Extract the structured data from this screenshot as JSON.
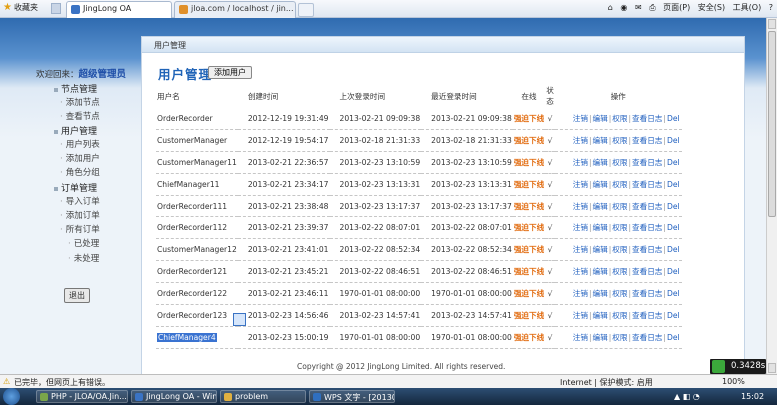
{
  "browser": {
    "favorites_label": "收藏夹",
    "tabs": [
      {
        "label": "JingLong OA",
        "active": true
      },
      {
        "label": "jloa.com / localhost / jin...",
        "active": false
      }
    ],
    "command_bar": [
      "页面(P)",
      "安全(S)",
      "工具(O)",
      "?"
    ]
  },
  "welcome": {
    "prefix": "欢迎回来：",
    "user": "超级管理员"
  },
  "sidebar": [
    {
      "label": "节点管理",
      "type": "cat"
    },
    {
      "label": "添加节点",
      "type": "sub"
    },
    {
      "label": "查看节点",
      "type": "sub"
    },
    {
      "label": "用户管理",
      "type": "cat"
    },
    {
      "label": "用户列表",
      "type": "sub"
    },
    {
      "label": "添加用户",
      "type": "sub"
    },
    {
      "label": "角色分组",
      "type": "sub"
    },
    {
      "label": "订单管理",
      "type": "cat"
    },
    {
      "label": "导入订单",
      "type": "sub"
    },
    {
      "label": "添加订单",
      "type": "sub"
    },
    {
      "label": "所有订单",
      "type": "sub"
    },
    {
      "label": "已处理",
      "type": "sub2"
    },
    {
      "label": "未处理",
      "type": "sub2"
    }
  ],
  "exit_label": "退出",
  "breadcrumb": "用户管理",
  "page_title": "用户管理",
  "add_user_label": "添加用户",
  "table": {
    "headers": [
      "用户名",
      "创建时间",
      "上次登录时间",
      "最近登录时间",
      "在线",
      "状态",
      "操作"
    ],
    "rows": [
      {
        "name": "OrderRecorder",
        "created": "2012-12-19 19:31:49",
        "last_login": "2013-02-21 09:09:38",
        "recent_login": "2013-02-21 09:09:38",
        "online": "强迫下线",
        "status": "√"
      },
      {
        "name": "CustomerManager",
        "created": "2012-12-19 19:54:17",
        "last_login": "2013-02-18 21:31:33",
        "recent_login": "2013-02-18 21:31:33",
        "online": "强迫下线",
        "status": "√"
      },
      {
        "name": "CustomerManager11",
        "created": "2013-02-21 22:36:57",
        "last_login": "2013-02-23 13:10:59",
        "recent_login": "2013-02-23 13:10:59",
        "online": "强迫下线",
        "status": "√"
      },
      {
        "name": "ChiefManager11",
        "created": "2013-02-21 23:34:17",
        "last_login": "2013-02-23 13:13:31",
        "recent_login": "2013-02-23 13:13:31",
        "online": "强迫下线",
        "status": "√"
      },
      {
        "name": "OrderRecorder111",
        "created": "2013-02-21 23:38:48",
        "last_login": "2013-02-23 13:17:37",
        "recent_login": "2013-02-23 13:17:37",
        "online": "强迫下线",
        "status": "√"
      },
      {
        "name": "OrderRecorder112",
        "created": "2013-02-21 23:39:37",
        "last_login": "2013-02-22 08:07:01",
        "recent_login": "2013-02-22 08:07:01",
        "online": "强迫下线",
        "status": "√"
      },
      {
        "name": "CustomerManager12",
        "created": "2013-02-21 23:41:01",
        "last_login": "2013-02-22 08:52:34",
        "recent_login": "2013-02-22 08:52:34",
        "online": "强迫下线",
        "status": "√"
      },
      {
        "name": "OrderRecorder121",
        "created": "2013-02-21 23:45:21",
        "last_login": "2013-02-22 08:46:51",
        "recent_login": "2013-02-22 08:46:51",
        "online": "强迫下线",
        "status": "√"
      },
      {
        "name": "OrderRecorder122",
        "created": "2013-02-21 23:46:11",
        "last_login": "1970-01-01 08:00:00",
        "recent_login": "1970-01-01 08:00:00",
        "online": "强迫下线",
        "status": "√"
      },
      {
        "name": "OrderRecorder123",
        "created": "2013-02-23 14:56:46",
        "last_login": "2013-02-23 14:57:41",
        "recent_login": "2013-02-23 14:57:41",
        "online": "强迫下线",
        "status": "√"
      },
      {
        "name": "ChiefManager4",
        "created": "2013-02-23 15:00:19",
        "last_login": "1970-01-01 08:00:00",
        "recent_login": "1970-01-01 08:00:00",
        "online": "强迫下线",
        "status": "√",
        "selected": true
      }
    ],
    "actions": [
      "注销",
      "编辑",
      "权限",
      "查看日志",
      "Del"
    ]
  },
  "footer": "Copyright @ 2012 JingLong Limited. All rights reserved.",
  "timer": "0.3428s",
  "statusbar": {
    "text": "已完毕，但网页上有错误。",
    "zone": "Internet | 保护模式: 启用",
    "zoom": "100%"
  },
  "taskbar": {
    "items": [
      {
        "label": "PHP - JLOA/OA.Jin...",
        "color": "#7aa64a"
      },
      {
        "label": "JingLong OA - Win...",
        "color": "#3a73c4"
      },
      {
        "label": "problem",
        "color": "#e0b040"
      },
      {
        "label": "WPS 文字 - [20130...",
        "color": "#2f6fbf"
      }
    ],
    "clock": "15:02"
  }
}
